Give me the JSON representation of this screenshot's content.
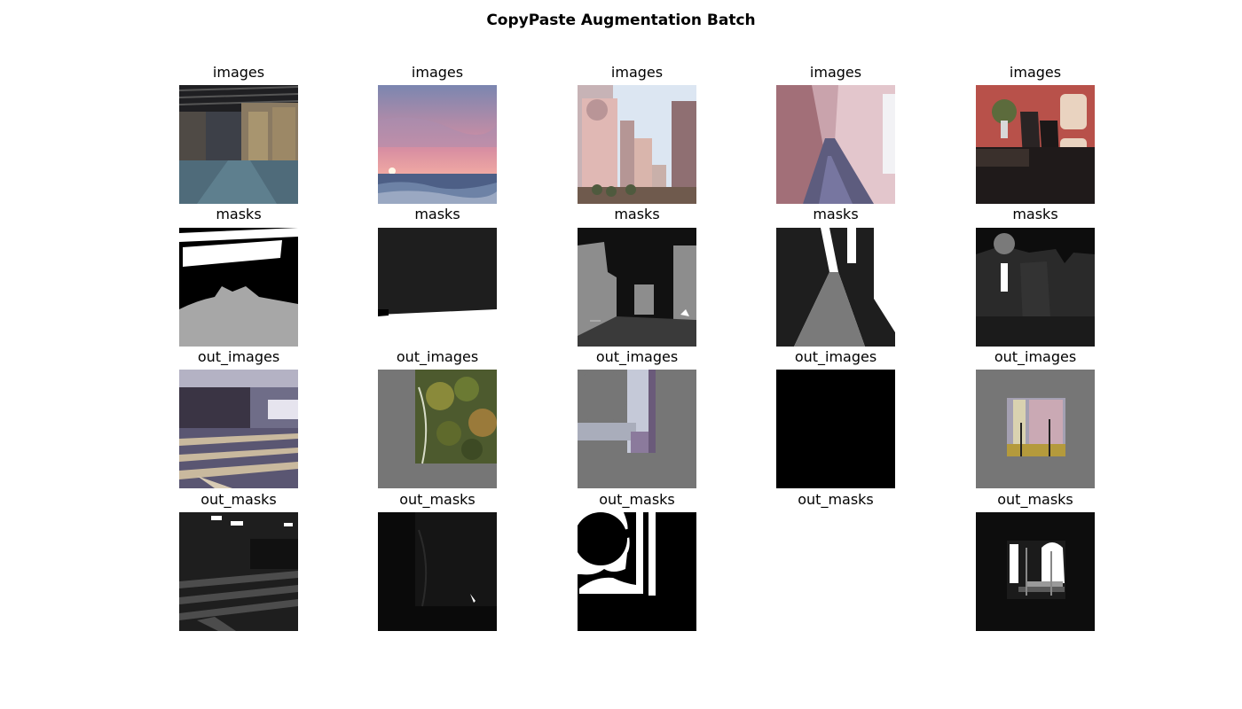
{
  "figure": {
    "title": "CopyPaste Augmentation Batch"
  },
  "rows": [
    {
      "label": "images",
      "cells": [
        "warehouse",
        "sunset-sea",
        "skyscrapers",
        "hallway",
        "dining-room"
      ]
    },
    {
      "label": "masks",
      "cells": [
        "warehouse-mask",
        "sunset-mask",
        "skyscrapers-mask",
        "hallway-mask",
        "dining-mask"
      ]
    },
    {
      "label": "out_images",
      "cells": [
        "classroom",
        "foliage-paste",
        "street-paste",
        "blank-black",
        "house-paste"
      ]
    },
    {
      "label": "out_masks",
      "cells": [
        "classroom-mask",
        "foliage-mask",
        "street-mask",
        "empty",
        "house-mask"
      ]
    }
  ],
  "colors": {
    "pad_gray": "#767676",
    "mask_dark": "#1e1e1e"
  }
}
